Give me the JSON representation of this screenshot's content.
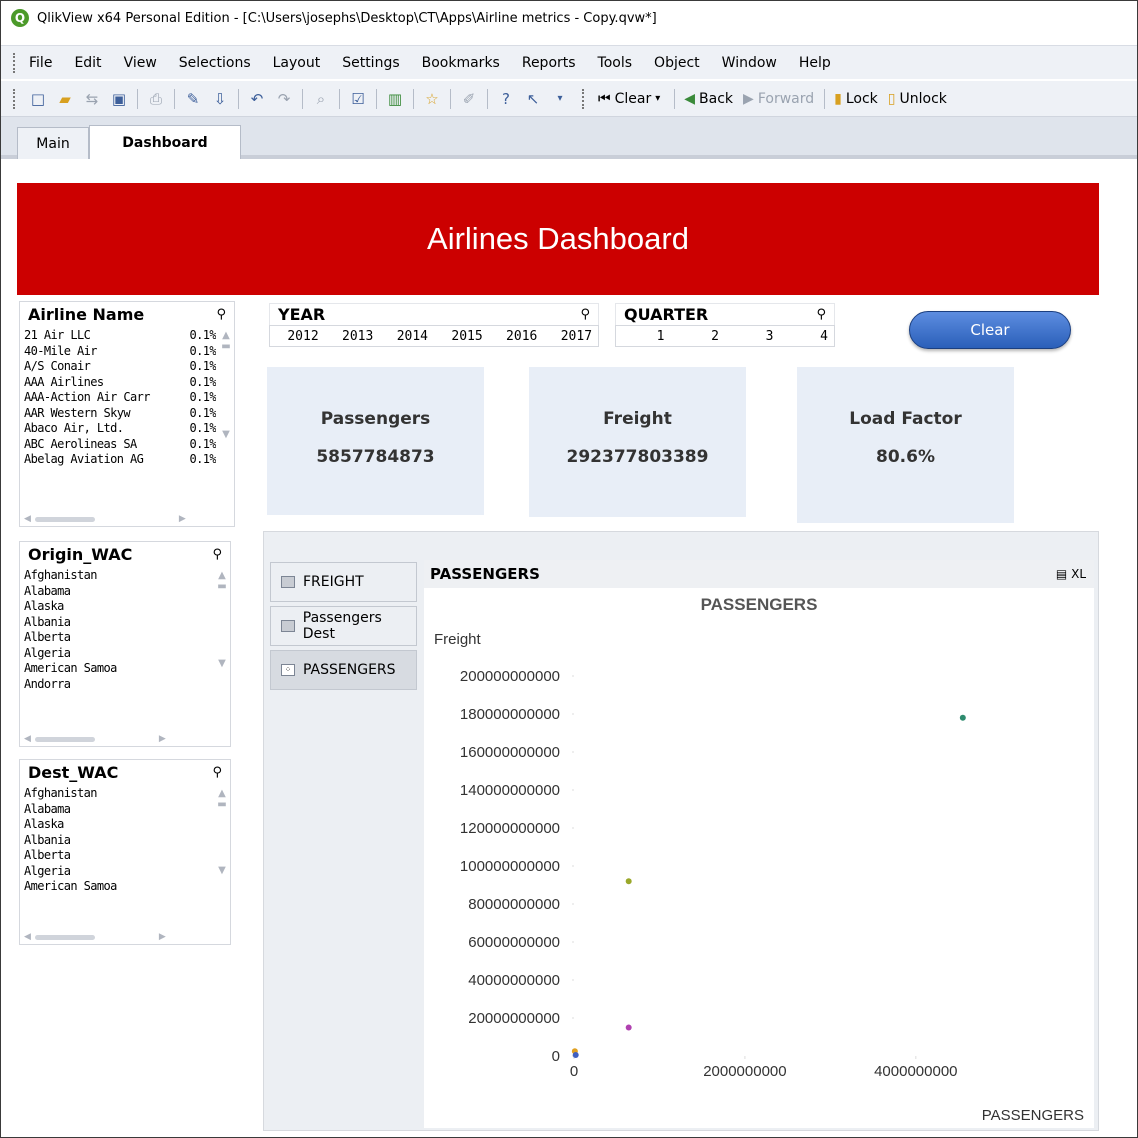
{
  "window": {
    "title": "QlikView x64 Personal Edition - [C:\\Users\\josephs\\Desktop\\CT\\Apps\\Airline metrics - Copy.qvw*]"
  },
  "menu": [
    "File",
    "Edit",
    "View",
    "Selections",
    "Layout",
    "Settings",
    "Bookmarks",
    "Reports",
    "Tools",
    "Object",
    "Window",
    "Help"
  ],
  "toolbar": {
    "clear": "Clear",
    "back": "Back",
    "forward": "Forward",
    "lock": "Lock",
    "unlock": "Unlock"
  },
  "tabs": [
    {
      "label": "Main"
    },
    {
      "label": "Dashboard",
      "active": true
    }
  ],
  "banner": {
    "title": "Airlines Dashboard",
    "color": "#cc0000"
  },
  "airline_list": {
    "title": "Airline Name",
    "items": [
      {
        "name": "21 Air LLC",
        "pct": "0.1%"
      },
      {
        "name": "40-Mile Air",
        "pct": "0.1%"
      },
      {
        "name": "A/S Conair",
        "pct": "0.1%"
      },
      {
        "name": "AAA Airlines",
        "pct": "0.1%"
      },
      {
        "name": "AAA-Action Air Carr",
        "pct": "0.1%"
      },
      {
        "name": "AAR Western Skyw",
        "pct": "0.1%"
      },
      {
        "name": "Abaco Air, Ltd.",
        "pct": "0.1%"
      },
      {
        "name": "ABC Aerolineas SA",
        "pct": "0.1%"
      },
      {
        "name": "Abelag Aviation AG",
        "pct": "0.1%"
      }
    ]
  },
  "origin_list": {
    "title": "Origin_WAC",
    "items": [
      "Afghanistan",
      "Alabama",
      "Alaska",
      "Albania",
      "Alberta",
      "Algeria",
      "American Samoa",
      "Andorra"
    ]
  },
  "dest_list": {
    "title": "Dest_WAC",
    "items": [
      "Afghanistan",
      "Alabama",
      "Alaska",
      "Albania",
      "Alberta",
      "Algeria",
      "American Samoa"
    ]
  },
  "year": {
    "title": "YEAR",
    "values": [
      "2012",
      "2013",
      "2014",
      "2015",
      "2016",
      "2017"
    ]
  },
  "quarter": {
    "title": "QUARTER",
    "values": [
      "1",
      "2",
      "3",
      "4"
    ]
  },
  "clear_button": "Clear",
  "kpis": [
    {
      "label": "Passengers",
      "value": "5857784873"
    },
    {
      "label": "Freight",
      "value": "292377803389"
    },
    {
      "label": "Load Factor",
      "value": "80.6%"
    }
  ],
  "container_tabs": [
    {
      "label": "FREIGHT",
      "icon": "table-icon"
    },
    {
      "label": "Passengers Dest",
      "icon": "table-icon"
    },
    {
      "label": "PASSENGERS",
      "icon": "scatter-icon",
      "active": true
    }
  ],
  "chart_caption": {
    "title": "PASSENGERS",
    "xl": "XL"
  },
  "chart_data": {
    "type": "scatter",
    "title": "PASSENGERS",
    "xlabel": "PASSENGERS",
    "ylabel": "Freight",
    "xlim": [
      0,
      5500000000
    ],
    "ylim": [
      0,
      200000000000
    ],
    "xticks": [
      0,
      2000000000,
      4000000000
    ],
    "yticks": [
      0,
      20000000000,
      40000000000,
      60000000000,
      80000000000,
      100000000000,
      120000000000,
      140000000000,
      160000000000,
      180000000000,
      200000000000
    ],
    "grid": false,
    "points": [
      {
        "x": 4550000000,
        "y": 178000000000,
        "color": "#2e8b6e"
      },
      {
        "x": 640000000,
        "y": 92000000000,
        "color": "#9aa82a"
      },
      {
        "x": 640000000,
        "y": 15000000000,
        "color": "#b040b0"
      },
      {
        "x": 10000000,
        "y": 2500000000,
        "color": "#e0a020"
      },
      {
        "x": 20000000,
        "y": 500000000,
        "color": "#4060c0"
      }
    ]
  }
}
